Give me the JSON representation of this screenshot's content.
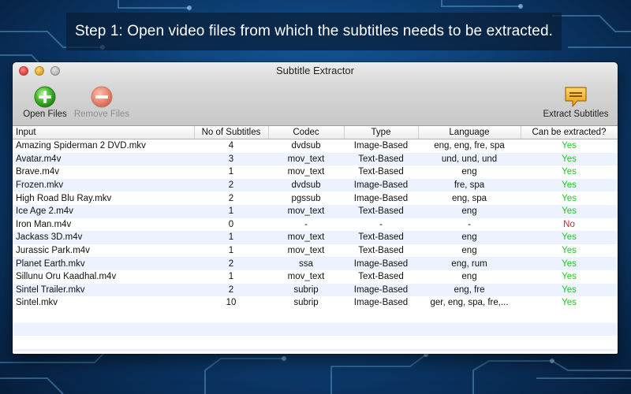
{
  "caption": "Step 1: Open video files from which the subtitles needs to be extracted.",
  "window": {
    "title": "Subtitle Extractor"
  },
  "toolbar": {
    "open_label": "Open Files",
    "remove_label": "Remove Files",
    "extract_label": "Extract Subtitles"
  },
  "colors": {
    "yes": "#20c820",
    "no": "#e01c1c",
    "row_alt": "#edf3fe"
  },
  "table": {
    "headers": [
      "Input",
      "No of Subtitles",
      "Codec",
      "Type",
      "Language",
      "Can be extracted?"
    ],
    "rows": [
      [
        "Amazing Spiderman 2 DVD.mkv",
        "4",
        "dvdsub",
        "Image-Based",
        "eng, eng, fre, spa",
        "Yes"
      ],
      [
        "Avatar.m4v",
        "3",
        "mov_text",
        "Text-Based",
        "und, und, und",
        "Yes"
      ],
      [
        "Brave.m4v",
        "1",
        "mov_text",
        "Text-Based",
        "eng",
        "Yes"
      ],
      [
        "Frozen.mkv",
        "2",
        "dvdsub",
        "Image-Based",
        "fre, spa",
        "Yes"
      ],
      [
        "High Road Blu Ray.mkv",
        "2",
        "pgssub",
        "Image-Based",
        "eng, spa",
        "Yes"
      ],
      [
        "Ice Age 2.m4v",
        "1",
        "mov_text",
        "Text-Based",
        "eng",
        "Yes"
      ],
      [
        "Iron Man.m4v",
        "0",
        "-",
        "-",
        "-",
        "No"
      ],
      [
        "Jackass 3D.m4v",
        "1",
        "mov_text",
        "Text-Based",
        "eng",
        "Yes"
      ],
      [
        "Jurassic Park.m4v",
        "1",
        "mov_text",
        "Text-Based",
        "eng",
        "Yes"
      ],
      [
        "Planet Earth.mkv",
        "2",
        "ssa",
        "Image-Based",
        "eng, rum",
        "Yes"
      ],
      [
        "Sillunu Oru Kaadhal.m4v",
        "1",
        "mov_text",
        "Text-Based",
        "eng",
        "Yes"
      ],
      [
        "Sintel Trailer.mkv",
        "2",
        "subrip",
        "Image-Based",
        "eng, fre",
        "Yes"
      ],
      [
        "Sintel.mkv",
        "10",
        "subrip",
        "Image-Based",
        "ger, eng, spa, fre,...",
        "Yes"
      ]
    ]
  }
}
